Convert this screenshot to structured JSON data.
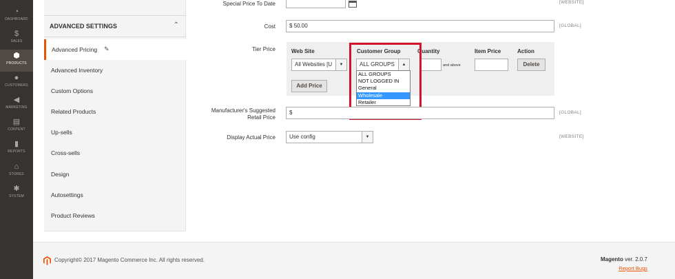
{
  "nav": {
    "items": [
      {
        "label": "DASHBOARD",
        "icon": "dashboard-icon",
        "glyph": "◔"
      },
      {
        "label": "SALES",
        "icon": "dollar-icon",
        "glyph": "$"
      },
      {
        "label": "PRODUCTS",
        "icon": "cube-icon",
        "glyph": "⬢"
      },
      {
        "label": "CUSTOMERS",
        "icon": "user-icon",
        "glyph": "●"
      },
      {
        "label": "MARKETING",
        "icon": "megaphone-icon",
        "glyph": "◀"
      },
      {
        "label": "CONTENT",
        "icon": "content-icon",
        "glyph": "▤"
      },
      {
        "label": "REPORTS",
        "icon": "bar-chart-icon",
        "glyph": "▮"
      },
      {
        "label": "STORES",
        "icon": "store-icon",
        "glyph": "⌂"
      },
      {
        "label": "SYSTEM",
        "icon": "gear-icon",
        "glyph": "✱"
      }
    ]
  },
  "panel": {
    "title": "ADVANCED SETTINGS",
    "chevron": "⌃",
    "pencil": "✎",
    "links": [
      "Advanced Pricing",
      "Advanced Inventory",
      "Custom Options",
      "Related Products",
      "Up-sells",
      "Cross-sells",
      "Design",
      "Autosettings",
      "Product Reviews"
    ]
  },
  "form": {
    "special_price_to_date_label": "Special Price To Date",
    "cost_label": "Cost",
    "cost_currency": "$",
    "cost_value": "50.00",
    "scope_global": "[GLOBAL]",
    "scope_website": "[WEBSITE]",
    "tier_price_label": "Tier Price",
    "tier": {
      "headers": {
        "website": "Web Site",
        "customer_group": "Customer Group",
        "quantity": "Quantity",
        "item_price": "Item Price",
        "action": "Action"
      },
      "website_value": "All Websites [U",
      "customer_group_value": "ALL GROUPS",
      "and_above": "and above",
      "delete_label": "Delete",
      "add_price_label": "Add Price",
      "options": [
        "ALL GROUPS",
        "NOT LOGGED IN",
        "General",
        "Wholesale",
        "Retailer"
      ],
      "highlighted_option": "Wholesale"
    },
    "msrp_label_line1": "Manufacturer's Suggested",
    "msrp_label_line2": "Retail Price",
    "msrp_currency": "$",
    "display_actual_price_label": "Display Actual Price",
    "display_actual_price_value": "Use config"
  },
  "footer": {
    "copyright": "Copyright© 2017 Magento Commerce Inc. All rights reserved.",
    "brand": "Magento",
    "version": "ver. 2.0.7",
    "report_bugs": "Report Bugs"
  },
  "colors": {
    "accent": "#eb5202",
    "highlight_border": "#d3142f",
    "selected_option": "#3399ff",
    "nav_bg": "#373330"
  }
}
